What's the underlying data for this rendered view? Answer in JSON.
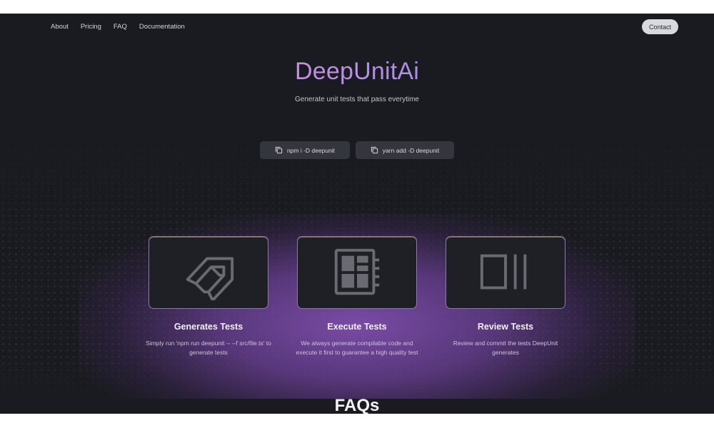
{
  "nav": {
    "items": [
      {
        "label": "About"
      },
      {
        "label": "Pricing"
      },
      {
        "label": "FAQ"
      },
      {
        "label": "Documentation"
      }
    ],
    "contact_label": "Contact"
  },
  "hero": {
    "title": "DeepUnitAi",
    "subtitle": "Generate unit tests that pass everytime"
  },
  "install": {
    "npm": {
      "label": "npm i -D deepunit",
      "icon": "copy-icon"
    },
    "yarn": {
      "label": "yarn add -D deepunit",
      "icon": "copy-icon"
    }
  },
  "features": [
    {
      "title": "Generates Tests",
      "description": "Simply run 'npm run deepunit -- --f src/file.ts' to generate tests",
      "icon": "generate-icon"
    },
    {
      "title": "Execute Tests",
      "description": "We always generate compilable code and execute it first to guarantee a high quality test",
      "icon": "chip-icon"
    },
    {
      "title": "Review Tests",
      "description": "Review and commit the tests DeepUnit generates",
      "icon": "review-icon"
    }
  ],
  "faq_heading": "FAQs",
  "colors": {
    "background": "#1a1b20",
    "accent_gradient_start": "#c88fe0",
    "accent_gradient_end": "#a98fe8",
    "glow": "#7e4eac"
  }
}
